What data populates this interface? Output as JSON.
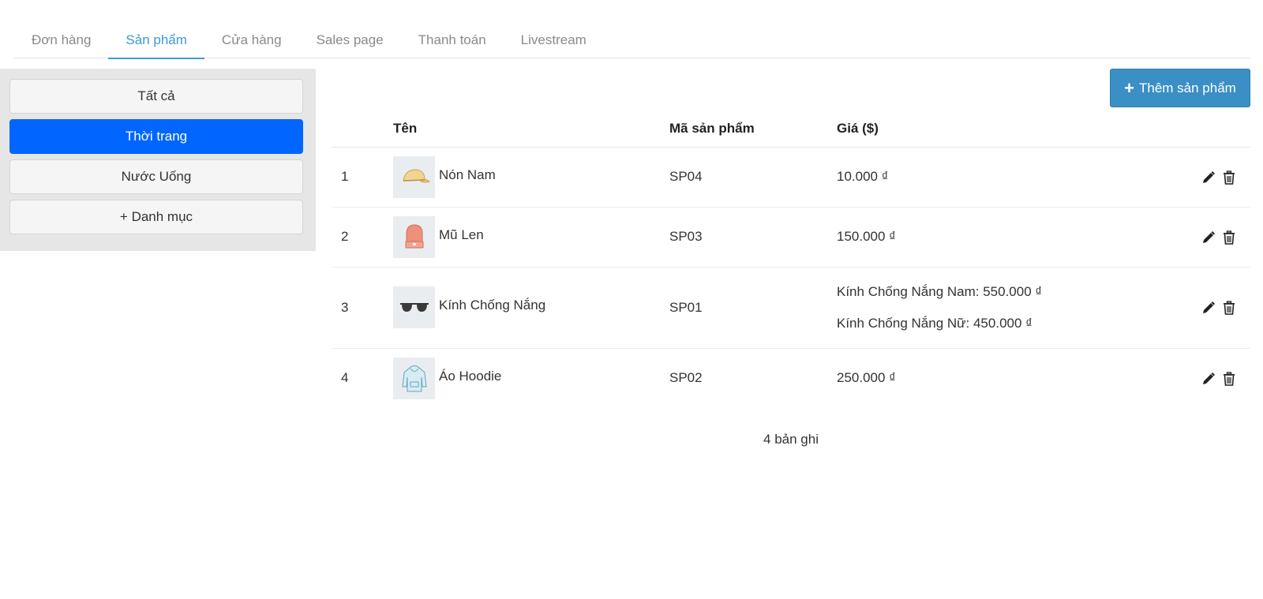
{
  "tabs": [
    {
      "label": "Đơn hàng",
      "active": false
    },
    {
      "label": "Sản phẩm",
      "active": true
    },
    {
      "label": "Cửa hàng",
      "active": false
    },
    {
      "label": "Sales page",
      "active": false
    },
    {
      "label": "Thanh toán",
      "active": false
    },
    {
      "label": "Livestream",
      "active": false
    }
  ],
  "categories": [
    {
      "label": "Tất cả",
      "active": false
    },
    {
      "label": "Thời trang",
      "active": true
    },
    {
      "label": "Nước Uống",
      "active": false
    },
    {
      "label": "+ Danh mục",
      "active": false
    }
  ],
  "add_button": {
    "label": "Thêm sản phẩm",
    "icon": "plus-icon"
  },
  "table": {
    "headers": {
      "index": "",
      "name": "Tên",
      "code": "Mã sản phẩm",
      "price": "Giá ($)"
    },
    "rows": [
      {
        "index": "1",
        "name": "Nón Nam",
        "code": "SP04",
        "prices": [
          "10.000 ₫"
        ],
        "thumb": "cap-icon"
      },
      {
        "index": "2",
        "name": "Mũ Len",
        "code": "SP03",
        "prices": [
          "150.000 ₫"
        ],
        "thumb": "beanie-icon"
      },
      {
        "index": "3",
        "name": "Kính Chống Nắng",
        "code": "SP01",
        "prices": [
          "Kính Chống Nắng Nam: 550.000 ₫",
          "Kính Chống Nắng Nữ: 450.000 ₫"
        ],
        "thumb": "sunglasses-icon"
      },
      {
        "index": "4",
        "name": "Áo Hoodie",
        "code": "SP02",
        "prices": [
          "250.000 ₫"
        ],
        "thumb": "hoodie-icon"
      }
    ]
  },
  "footer": {
    "count_label": "4 bản ghi"
  },
  "colors": {
    "accent": "#3a9bd6",
    "active_category": "#0066ff",
    "add_button": "#3a8fc5"
  }
}
